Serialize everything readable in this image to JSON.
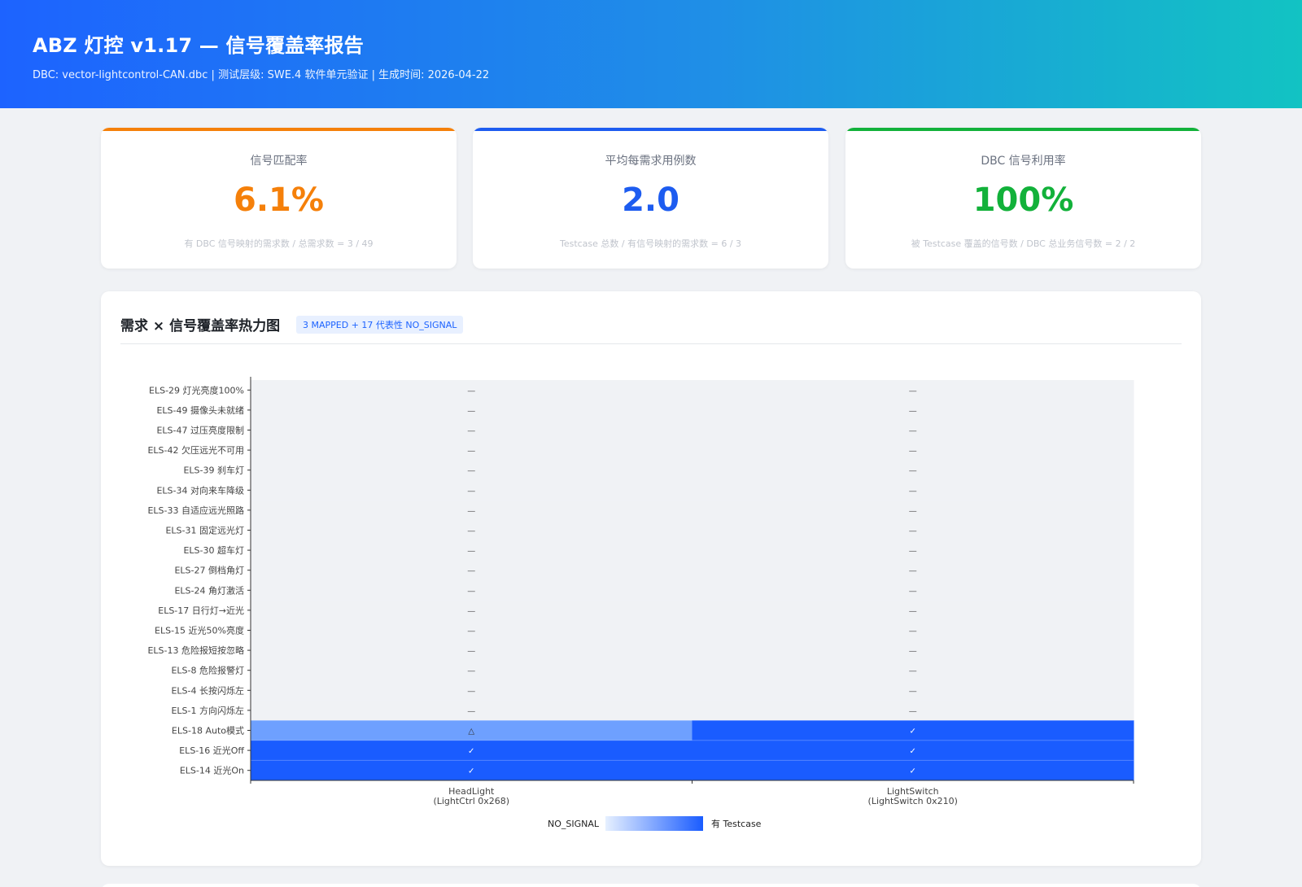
{
  "header": {
    "title": "ABZ 灯控 v1.17 — 信号覆盖率报告",
    "subtitle": "DBC: vector-lightcontrol-CAN.dbc | 测试层级: SWE.4 软件单元验证 | 生成时间: 2026-04-22"
  },
  "cards": [
    {
      "label": "信号匹配率",
      "value": "6.1%",
      "note": "有 DBC 信号映射的需求数 / 总需求数 = 3 / 49",
      "color": "#f5800a"
    },
    {
      "label": "平均每需求用例数",
      "value": "2.0",
      "note": "Testcase 总数 / 有信号映射的需求数 = 6 / 3",
      "color": "#1d5cf0"
    },
    {
      "label": "DBC 信号利用率",
      "value": "100%",
      "note": "被 Testcase 覆盖的信号数 / DBC 总业务信号数 = 2 / 2",
      "color": "#12b13a"
    }
  ],
  "heatmap": {
    "title": "需求 × 信号覆盖率热力图",
    "badge": "3 MAPPED + 17 代表性 NO_SIGNAL",
    "legend_low": "NO_SIGNAL",
    "legend_high": "有 Testcase",
    "colors": {
      "none": "#f0f2f5",
      "partial": "#6ea0ff",
      "full": "#1a5cff",
      "grad_start": "#e6f0ff",
      "grad_end": "#1a5cff"
    }
  },
  "chart_data": {
    "type": "heatmap",
    "x": [
      "HeadLight\n(LightCtrl 0x268)",
      "LightSwitch\n(LightSwitch 0x210)"
    ],
    "y": [
      "ELS-29 灯光亮度100%",
      "ELS-49 摄像头未就绪",
      "ELS-47 过压亮度限制",
      "ELS-42 欠压远光不可用",
      "ELS-39 刹车灯",
      "ELS-34 对向来车降级",
      "ELS-33 自适应远光照路",
      "ELS-31 固定远光灯",
      "ELS-30 超车灯",
      "ELS-27 倒档角灯",
      "ELS-24 角灯激活",
      "ELS-17 日行灯→近光",
      "ELS-15 近光50%亮度",
      "ELS-13 危险报短按忽略",
      "ELS-8  危险报警灯",
      "ELS-4  长按闪烁左",
      "ELS-1  方向闪烁左",
      "ELS-18 Auto模式",
      "ELS-16 近光Off",
      "ELS-14 近光On"
    ],
    "values": [
      [
        0,
        0
      ],
      [
        0,
        0
      ],
      [
        0,
        0
      ],
      [
        0,
        0
      ],
      [
        0,
        0
      ],
      [
        0,
        0
      ],
      [
        0,
        0
      ],
      [
        0,
        0
      ],
      [
        0,
        0
      ],
      [
        0,
        0
      ],
      [
        0,
        0
      ],
      [
        0,
        0
      ],
      [
        0,
        0
      ],
      [
        0,
        0
      ],
      [
        0,
        0
      ],
      [
        0,
        0
      ],
      [
        0,
        0
      ],
      [
        0.5,
        1
      ],
      [
        1,
        1
      ],
      [
        1,
        1
      ]
    ],
    "marks": [
      [
        "—",
        "—"
      ],
      [
        "—",
        "—"
      ],
      [
        "—",
        "—"
      ],
      [
        "—",
        "—"
      ],
      [
        "—",
        "—"
      ],
      [
        "—",
        "—"
      ],
      [
        "—",
        "—"
      ],
      [
        "—",
        "—"
      ],
      [
        "—",
        "—"
      ],
      [
        "—",
        "—"
      ],
      [
        "—",
        "—"
      ],
      [
        "—",
        "—"
      ],
      [
        "—",
        "—"
      ],
      [
        "—",
        "—"
      ],
      [
        "—",
        "—"
      ],
      [
        "—",
        "—"
      ],
      [
        "—",
        "—"
      ],
      [
        "△",
        "✓"
      ],
      [
        "✓",
        "✓"
      ],
      [
        "✓",
        "✓"
      ]
    ]
  }
}
